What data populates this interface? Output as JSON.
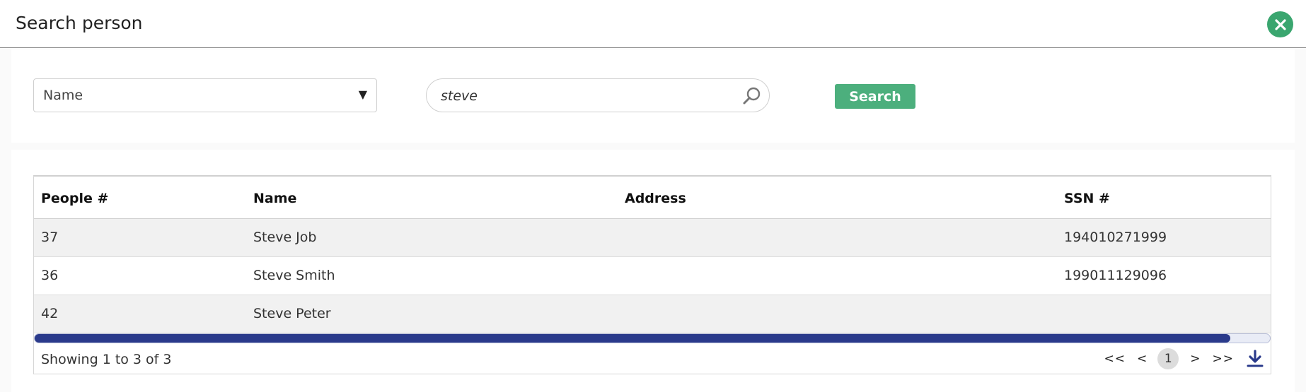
{
  "dialog": {
    "title": "Search person",
    "close_icon": "close-circle-icon",
    "accent_color": "#3aa66f"
  },
  "filter": {
    "field_select": {
      "selected": "Name",
      "arrow": "▼"
    },
    "search": {
      "value": "steve",
      "icon": "search-icon"
    },
    "search_button_label": "Search"
  },
  "table": {
    "columns": [
      "People #",
      "Name",
      "Address",
      "SSN #"
    ],
    "rows": [
      {
        "people": "37",
        "name": "Steve Job",
        "address": "",
        "ssn": "194010271999"
      },
      {
        "people": "36",
        "name": "Steve Smith",
        "address": "",
        "ssn": "199011129096"
      },
      {
        "people": "42",
        "name": "Steve Peter",
        "address": "",
        "ssn": ""
      }
    ],
    "scrollbar_color": "#2a3a8b"
  },
  "footer": {
    "info": "Showing 1 to 3 of 3",
    "pager": {
      "first": "<<",
      "prev": "<",
      "current": "1",
      "next": ">",
      "last": ">>"
    },
    "download_icon": "download-icon"
  }
}
